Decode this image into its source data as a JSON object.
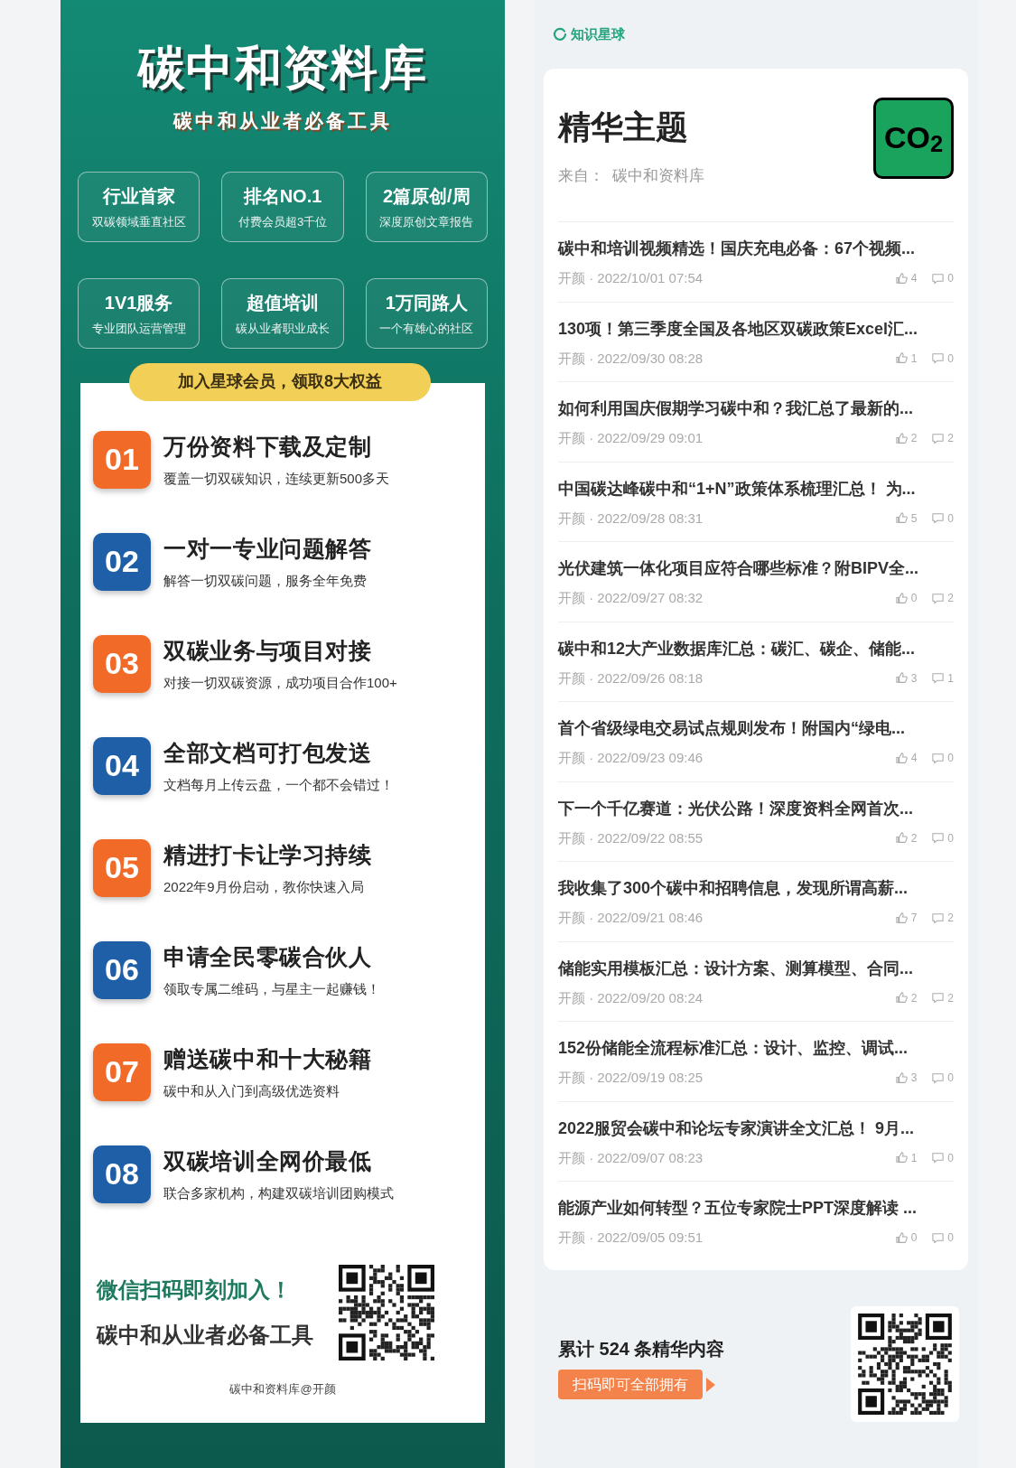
{
  "left": {
    "title": "碳中和资料库",
    "subtitle": "碳中和从业者必备工具",
    "features": [
      {
        "title": "行业首家",
        "caption": "双碳领域垂直社区"
      },
      {
        "title": "排名NO.1",
        "caption": "付费会员超3千位"
      },
      {
        "title": "2篇原创/周",
        "caption": "深度原创文章报告"
      },
      {
        "title": "1V1服务",
        "caption": "专业团队运营管理"
      },
      {
        "title": "超值培训",
        "caption": "碳从业者职业成长"
      },
      {
        "title": "1万同路人",
        "caption": "一个有雄心的社区"
      }
    ],
    "banner": "加入星球会员，领取8大权益",
    "benefits": [
      {
        "number": "01",
        "color": "#f26a27",
        "title": "万份资料下载及定制",
        "caption": "覆盖一切双碳知识，连续更新500多天"
      },
      {
        "number": "02",
        "color": "#1f5fa8",
        "title": "一对一专业问题解答",
        "caption": "解答一切双碳问题，服务全年免费"
      },
      {
        "number": "03",
        "color": "#f26a27",
        "title": "双碳业务与项目对接",
        "caption": "对接一切双碳资源，成功项目合作100+"
      },
      {
        "number": "04",
        "color": "#1f5fa8",
        "title": "全部文档可打包发送",
        "caption": "文档每月上传云盘，一个都不会错过！"
      },
      {
        "number": "05",
        "color": "#f26a27",
        "title": "精进打卡让学习持续",
        "caption": "2022年9月份启动，教你快速入局"
      },
      {
        "number": "06",
        "color": "#1f5fa8",
        "title": "申请全民零碳合伙人",
        "caption": "领取专属二维码，与星主一起赚钱！"
      },
      {
        "number": "07",
        "color": "#f26a27",
        "title": "赠送碳中和十大秘籍",
        "caption": "碳中和从入门到高级优选资料"
      },
      {
        "number": "08",
        "color": "#1f5fa8",
        "title": "双碳培训全网价最低",
        "caption": "联合多家机构，构建双碳培训团购模式"
      }
    ],
    "cta": {
      "line_1": "微信扫码即刻加入！",
      "line_2": "碳中和从业者必备工具"
    },
    "footer": "碳中和资料库@开颜"
  },
  "right": {
    "brand": "知识星球",
    "heading": "精华主题",
    "source": "来自：  碳中和资料库",
    "avatar": "CO$_{2}$",
    "topics": [
      {
        "title": "碳中和培训视频精选！国庆充电必备：67个视频...",
        "meta": "开颜 · 2022/10/01 07:54",
        "likes": "4",
        "comments": "0"
      },
      {
        "title": "130项！第三季度全国及各地区双碳政策Excel汇...",
        "meta": "开颜 · 2022/09/30 08:28",
        "likes": "1",
        "comments": "0"
      },
      {
        "title": "如何利用国庆假期学习碳中和？我汇总了最新的...",
        "meta": "开颜 · 2022/09/29 09:01",
        "likes": "2",
        "comments": "2"
      },
      {
        "title": "中国碳达峰碳中和“1+N”政策体系梳理汇总！ 为...",
        "meta": "开颜 · 2022/09/28 08:31",
        "likes": "5",
        "comments": "0"
      },
      {
        "title": "光伏建筑一体化项目应符合哪些标准？附BIPV全...",
        "meta": "开颜 · 2022/09/27 08:32",
        "likes": "0",
        "comments": "2"
      },
      {
        "title": "碳中和12大产业数据库汇总：碳汇、碳企、储能...",
        "meta": "开颜 · 2022/09/26 08:18",
        "likes": "3",
        "comments": "1"
      },
      {
        "title": "首个省级绿电交易试点规则发布！附国内“绿电...",
        "meta": "开颜 · 2022/09/23 09:46",
        "likes": "4",
        "comments": "0"
      },
      {
        "title": "下一个千亿赛道：光伏公路！深度资料全网首次...",
        "meta": "开颜 · 2022/09/22 08:55",
        "likes": "2",
        "comments": "0"
      },
      {
        "title": "我收集了300个碳中和招聘信息，发现所谓高薪...",
        "meta": "开颜 · 2022/09/21 08:46",
        "likes": "7",
        "comments": "2"
      },
      {
        "title": "储能实用模板汇总：设计方案、测算模型、合同...",
        "meta": "开颜 · 2022/09/20 08:24",
        "likes": "2",
        "comments": "2"
      },
      {
        "title": "152份储能全流程标准汇总：设计、监控、调试...",
        "meta": "开颜 · 2022/09/19 08:25",
        "likes": "3",
        "comments": "0"
      },
      {
        "title": "2022服贸会碳中和论坛专家演讲全文汇总！ 9月...",
        "meta": "开颜 · 2022/09/07 08:23",
        "likes": "1",
        "comments": "0"
      },
      {
        "title": "能源产业如何转型？五位专家院士PPT深度解读 ...",
        "meta": "开颜 · 2022/09/05 09:51",
        "likes": "0",
        "comments": "0"
      }
    ],
    "total": "累计 524 条精华内容",
    "button": "扫码即可全部拥有"
  }
}
